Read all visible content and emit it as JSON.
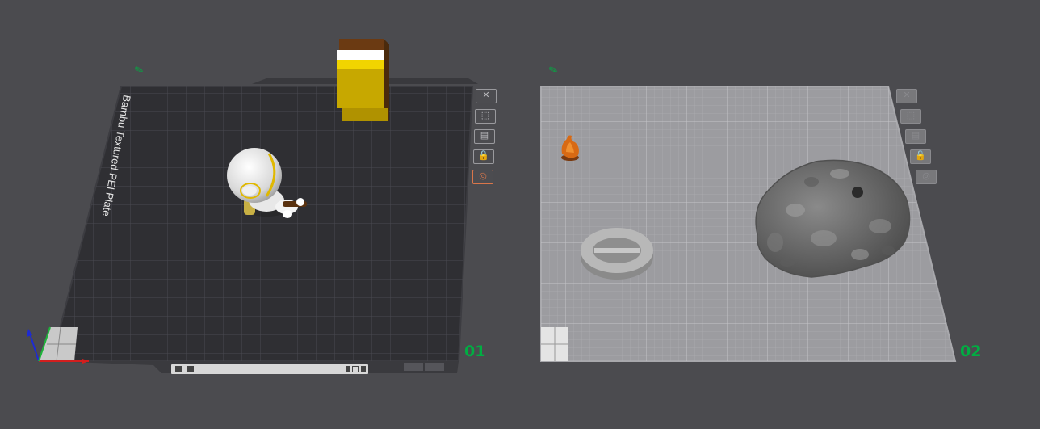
{
  "plates": [
    {
      "index_label": "01",
      "name": "Bambu Textured PEI Plate",
      "controls": [
        {
          "name": "close",
          "icon": "close-icon",
          "glyph": "✕"
        },
        {
          "name": "auto-orient",
          "icon": "orient-icon",
          "glyph": "⬚"
        },
        {
          "name": "arrange",
          "icon": "arrange-icon",
          "glyph": "▤"
        },
        {
          "name": "lock",
          "icon": "lock-icon",
          "glyph": "🔓"
        },
        {
          "name": "settings",
          "icon": "plate-settings-icon",
          "glyph": "◎"
        }
      ],
      "state": "selected"
    },
    {
      "index_label": "02",
      "name": "",
      "controls": [
        {
          "name": "close",
          "icon": "close-icon",
          "glyph": "✕"
        },
        {
          "name": "auto-orient",
          "icon": "orient-icon",
          "glyph": "⬚"
        },
        {
          "name": "arrange",
          "icon": "arrange-icon",
          "glyph": "▤"
        },
        {
          "name": "lock",
          "icon": "lock-icon",
          "glyph": "🔓"
        },
        {
          "name": "settings",
          "icon": "plate-settings-icon",
          "glyph": "◎"
        }
      ],
      "state": "unselected"
    }
  ],
  "edit_mark": "✎",
  "colors": {
    "background": "#4b4b4f",
    "plate_dark": "#2f2f33",
    "plate_light": "#9c9ca0",
    "accent_green": "#00ae42",
    "active_orange": "#d9764a",
    "object_yellow": "#e8c700",
    "object_brown": "#6b3a12",
    "object_grey": "#6a6a6a"
  }
}
